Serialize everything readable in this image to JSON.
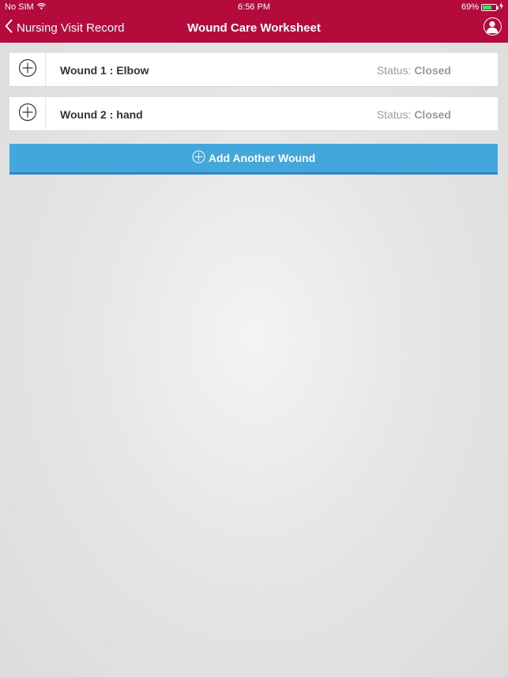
{
  "status_bar": {
    "carrier": "No SIM",
    "time": "6:56 PM",
    "battery": "69%",
    "battery_level": 0.69,
    "battery_color": "#4cd964"
  },
  "nav": {
    "back_label": "Nursing Visit Record",
    "title": "Wound Care Worksheet",
    "back_icon": "chevron-left-icon",
    "profile_icon": "user-profile-icon",
    "bar_color": "#b50a3c"
  },
  "wounds": [
    {
      "name": "Wound 1 : Elbow",
      "status_label": "Status:",
      "status_value": "Closed"
    },
    {
      "name": "Wound 2 : hand",
      "status_label": "Status:",
      "status_value": "Closed"
    }
  ],
  "add_button": {
    "label": "Add Another Wound",
    "icon": "plus-circle-icon",
    "color": "#43a7dc"
  }
}
